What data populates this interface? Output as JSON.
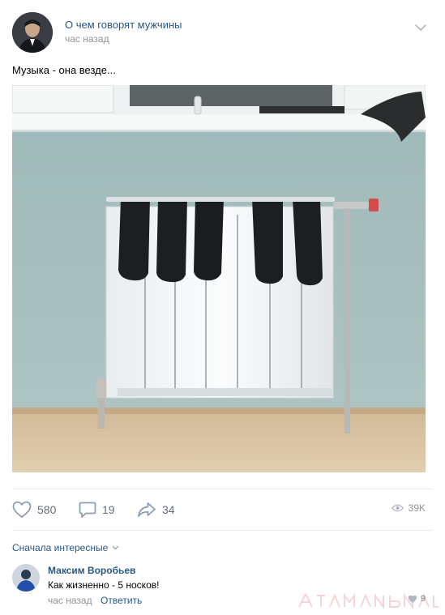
{
  "post": {
    "group_name": "О чем говорят мужчины",
    "time": "час назад",
    "text": "Музыка - она везде..."
  },
  "actions": {
    "likes": "580",
    "comments": "19",
    "shares": "34",
    "views": "39K"
  },
  "comments_section": {
    "sort_label": "Сначала интересные",
    "comment": {
      "author": "Максим Воробьев",
      "text": "Как жизненно - 5 носков!",
      "time": "час назад",
      "reply_label": "Ответить",
      "likes": "9"
    }
  },
  "colors": {
    "link": "#2a5885",
    "meta": "#939393",
    "action": "#626d7a",
    "wall": "#a9c1c2",
    "floor": "#d9c3a2"
  },
  "icons": [
    "group-avatar",
    "chevron-down-icon",
    "heart-icon",
    "comment-icon",
    "share-icon",
    "eye-icon",
    "user-avatar",
    "small-heart-icon"
  ]
}
